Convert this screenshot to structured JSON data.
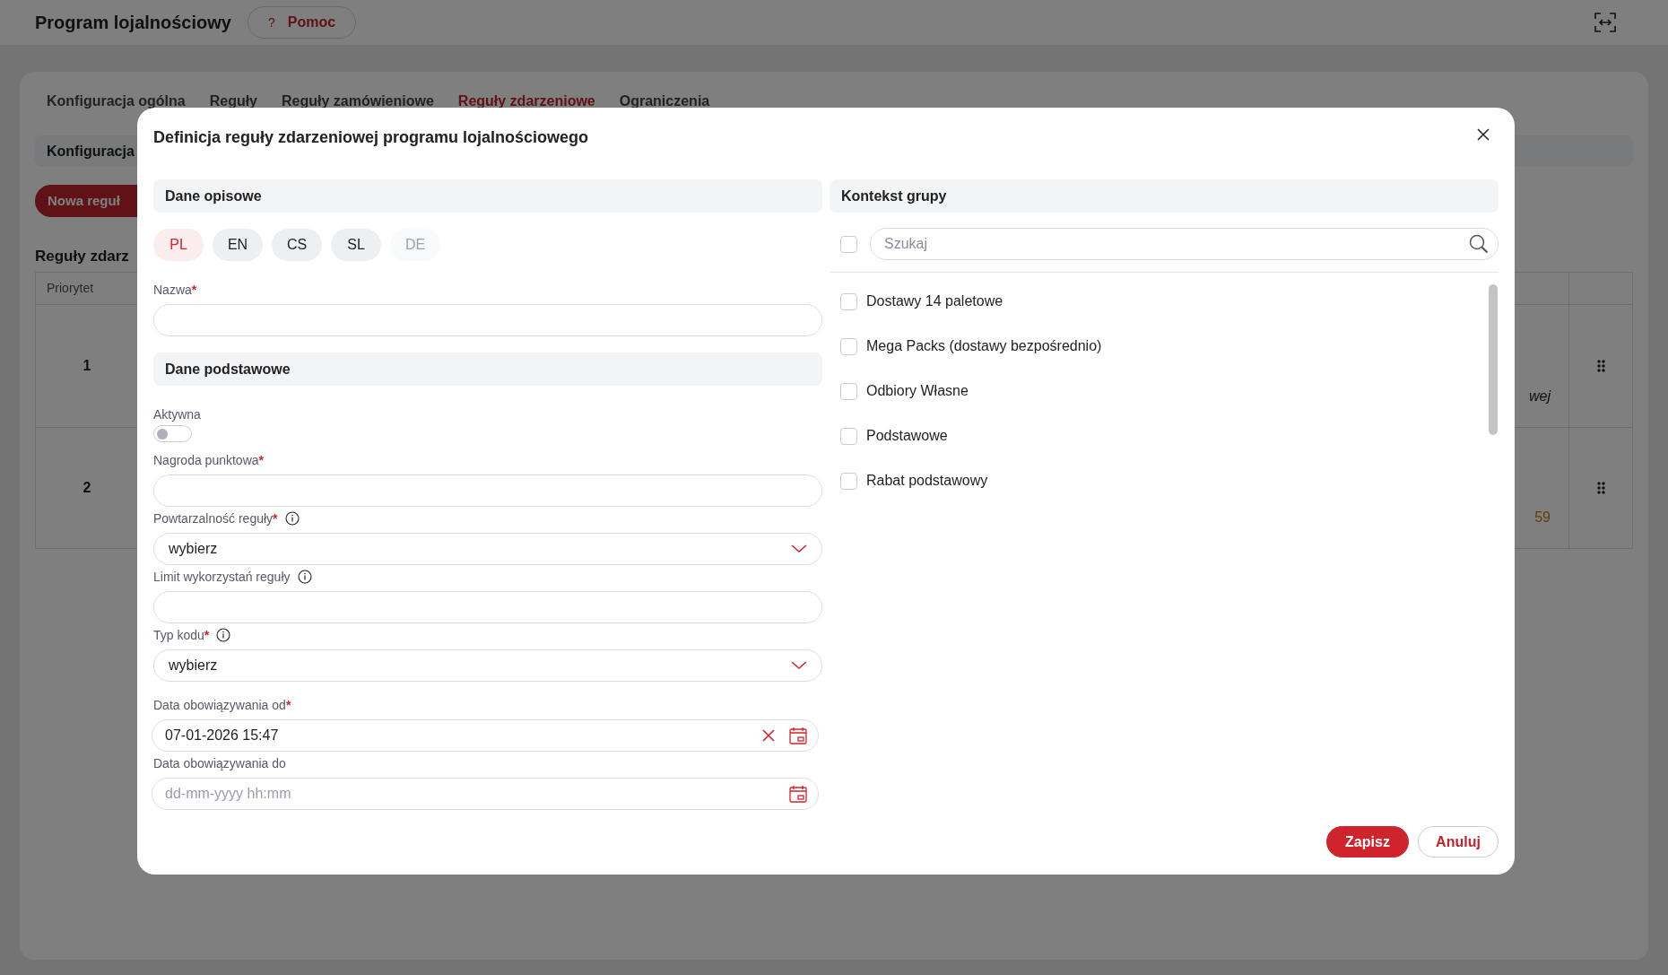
{
  "header": {
    "title": "Program lojalnościowy",
    "help_button": {
      "icon": "?",
      "label": "Pomoc"
    }
  },
  "tabs": [
    {
      "label": "Konfiguracja ogólna",
      "selected": false
    },
    {
      "label": "Reguły",
      "selected": false
    },
    {
      "label": "Reguły zamówieniowe",
      "selected": false
    },
    {
      "label": "Reguły zdarzeniowe",
      "selected": true
    },
    {
      "label": "Ograniczenia",
      "selected": false
    }
  ],
  "section_bar": "Konfiguracja",
  "new_button": "Nowa reguł",
  "heading": "Reguły zdarz",
  "table": {
    "columns": [
      "Priorytet"
    ],
    "rows": [
      {
        "priority": "1",
        "fragment": {
          "text": "wej",
          "kind": "italic"
        }
      },
      {
        "priority": "2",
        "fragment": {
          "text": "59",
          "kind": "amount"
        }
      }
    ]
  },
  "modal": {
    "title": "Definicja reguły zdarzeniowej programu lojalnościowego",
    "left_column": [
      {
        "kind": "section",
        "title": "Dane opisowe"
      },
      {
        "kind": "languages",
        "items": [
          {
            "label": "PL",
            "selected": true,
            "disabled": false
          },
          {
            "label": "EN",
            "selected": false,
            "disabled": false
          },
          {
            "label": "CS",
            "selected": false,
            "disabled": false
          },
          {
            "label": "SL",
            "selected": false,
            "disabled": false
          },
          {
            "label": "DE",
            "selected": false,
            "disabled": true
          }
        ]
      },
      {
        "kind": "text",
        "label": "Nazwa",
        "required_mark": "*",
        "info": false
      },
      {
        "kind": "section",
        "title": "Dane podstawowe"
      },
      {
        "kind": "toggle",
        "label": "Aktywna",
        "info": false,
        "on": false
      },
      {
        "kind": "text",
        "label": "Nagroda punktowa",
        "required_mark": "*",
        "info": false
      },
      {
        "kind": "select",
        "label": "Powtarzalność reguły",
        "required_mark": "*",
        "info": true,
        "value": "wybierz"
      },
      {
        "kind": "text",
        "label": "Limit wykorzystań reguły",
        "info": true
      },
      {
        "kind": "select",
        "label": "Typ kodu",
        "required_mark": "*",
        "info": true,
        "value": "wybierz"
      },
      {
        "kind": "date",
        "label": "Data obowiązywania od",
        "required_mark": "*",
        "info": false,
        "value": "07-01-2026 15:47"
      },
      {
        "kind": "date",
        "label": "Data obowiązywania do",
        "info": false,
        "placeholder": "dd-mm-yyyy hh:mm"
      }
    ],
    "right_column": {
      "title": "Kontekst grupy",
      "select_all": {
        "checked": false
      },
      "search": {
        "placeholder": "Szukaj"
      },
      "items": [
        {
          "label": "Dostawy 14 paletowe",
          "checked": false
        },
        {
          "label": "Mega Packs (dostawy bezpośrednio)",
          "checked": false
        },
        {
          "label": "Odbiory Własne",
          "checked": false
        },
        {
          "label": "Podstawowe",
          "checked": false
        },
        {
          "label": "Rabat podstawowy",
          "checked": false
        }
      ]
    },
    "buttons": [
      {
        "label": "Zapisz",
        "kind": "primary"
      },
      {
        "label": "Anuluj",
        "kind": "secondary"
      }
    ]
  }
}
